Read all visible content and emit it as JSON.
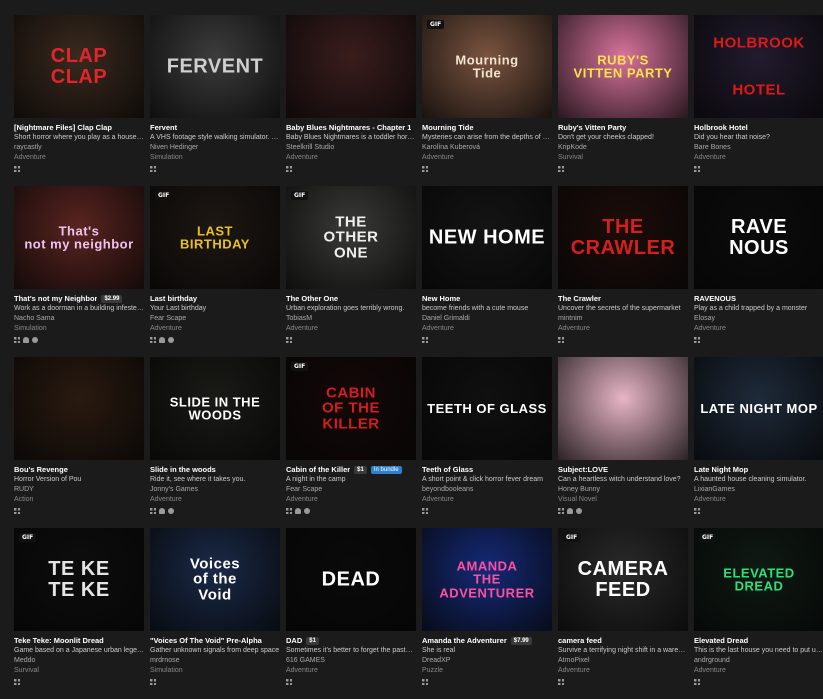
{
  "games": [
    {
      "title": "[Nightmare Files] Clap Clap",
      "desc": "Short horror where you play as a house si…",
      "author": "raycastly",
      "genre": "Adventure",
      "platforms": [
        "windows"
      ],
      "thumb_text": "CLAP\nCLAP",
      "thumb_bg": "#3a2a1e",
      "thumb_fg": "#e0262c",
      "gif": "",
      "price": "",
      "bundle": ""
    },
    {
      "title": "Fervent",
      "desc": "A VHS footage style walking simulator. E…",
      "author": "Niven Hedinger",
      "genre": "Simulation",
      "platforms": [
        "windows"
      ],
      "thumb_text": "FERVENT",
      "thumb_bg": "#3c3c3c",
      "thumb_fg": "#cfcfcf",
      "gif": "",
      "price": "",
      "bundle": ""
    },
    {
      "title": "Baby Blues Nightmares - Chapter 1",
      "desc": "Baby Blues Nightmares is a toddler horro…",
      "author": "Steelkrill Studio",
      "genre": "Adventure",
      "platforms": [
        "windows"
      ],
      "thumb_text": "",
      "thumb_bg": "#3a1d1d",
      "thumb_fg": "#ff3030",
      "gif": "",
      "price": "",
      "bundle": ""
    },
    {
      "title": "Mourning Tide",
      "desc": "Mysteries can arise from the depths of gr…",
      "author": "Karolína Kuberová",
      "genre": "Adventure",
      "platforms": [
        "windows"
      ],
      "thumb_text": "Mourning\nTide",
      "thumb_bg": "#7a5440",
      "thumb_fg": "#f2e3cf",
      "gif": "GIF",
      "price": "",
      "bundle": ""
    },
    {
      "title": "Ruby's Vitten Party",
      "desc": "Don't get your cheeks clapped!",
      "author": "KripKode",
      "genre": "Survival",
      "platforms": [
        "windows"
      ],
      "thumb_text": "RUBY'S\nVITTEN PARTY",
      "thumb_bg": "#d9739d",
      "thumb_fg": "#ffe14a",
      "gif": "",
      "price": "",
      "bundle": ""
    },
    {
      "title": "Holbrook Hotel",
      "desc": "Did you hear that noise?",
      "author": "Bare Bones",
      "genre": "Adventure",
      "platforms": [
        "windows"
      ],
      "thumb_text": "HOLBROOK\n\n\nHOTEL",
      "thumb_bg": "#221b2e",
      "thumb_fg": "#e01818",
      "gif": "",
      "price": "",
      "bundle": ""
    },
    {
      "title": "That's not my Neighbor",
      "desc": "Work as a doorman in a building infested …",
      "author": "Nacho Sama",
      "genre": "Simulation",
      "platforms": [
        "windows",
        "linux",
        "mac"
      ],
      "thumb_text": "That's\nnot my neighbor",
      "thumb_bg": "#5a2420",
      "thumb_fg": "#efc3ef",
      "gif": "",
      "price": "$2.99",
      "bundle": ""
    },
    {
      "title": "Last birthday",
      "desc": "Your Last birthday",
      "author": "Fear Scape",
      "genre": "Adventure",
      "platforms": [
        "windows",
        "linux",
        "mac"
      ],
      "thumb_text": "LAST\nBIRTHDAY",
      "thumb_bg": "#1e1713",
      "thumb_fg": "#e8c21c",
      "gif": "GIF",
      "price": "",
      "bundle": ""
    },
    {
      "title": "The Other One",
      "desc": "Urban exploration goes terribly wrong.",
      "author": "TobiasM",
      "genre": "Adventure",
      "platforms": [
        "windows"
      ],
      "thumb_text": "THE\nOTHER\nONE",
      "thumb_bg": "#3a3a38",
      "thumb_fg": "#f0f0f0",
      "gif": "GIF",
      "price": "",
      "bundle": ""
    },
    {
      "title": "New Home",
      "desc": "become friends with a cute mouse",
      "author": "Daniel Grimaldi",
      "genre": "Adventure",
      "platforms": [
        "windows"
      ],
      "thumb_text": "NEW HOME",
      "thumb_bg": "#141414",
      "thumb_fg": "#ffffff",
      "gif": "",
      "price": "",
      "bundle": ""
    },
    {
      "title": "The Crawler",
      "desc": "Uncover the secrets of the supermarket",
      "author": "mintnim",
      "genre": "Adventure",
      "platforms": [
        "windows"
      ],
      "thumb_text": "THE CRAWLER",
      "thumb_bg": "#1c0d0a",
      "thumb_fg": "#d2201e",
      "gif": "",
      "price": "",
      "bundle": ""
    },
    {
      "title": "RAVENOUS",
      "desc": "Play as a child trapped by a monster",
      "author": "Elosay",
      "genre": "Adventure",
      "platforms": [
        "windows"
      ],
      "thumb_text": "RAVE\nNOUS",
      "thumb_bg": "#0c0c0c",
      "thumb_fg": "#ffffff",
      "gif": "",
      "price": "",
      "bundle": ""
    },
    {
      "title": "Bou's Revenge",
      "desc": "Horror Version of Pou",
      "author": "RUDY",
      "genre": "Action",
      "platforms": [
        "windows"
      ],
      "thumb_text": "",
      "thumb_bg": "#2a1a10",
      "thumb_fg": "#b86a3c",
      "gif": "",
      "price": "",
      "bundle": ""
    },
    {
      "title": "Slide in the woods",
      "desc": "Ride it, see where it takes you.",
      "author": "Jonny's Games",
      "genre": "Adventure",
      "platforms": [
        "windows",
        "linux",
        "mac"
      ],
      "thumb_text": "SLIDE IN THE WOODS",
      "thumb_bg": "#1a1a16",
      "thumb_fg": "#ffffff",
      "gif": "",
      "price": "",
      "bundle": ""
    },
    {
      "title": "Cabin of the Killer",
      "desc": "A night in the camp",
      "author": "Fear Scape",
      "genre": "Adventure",
      "platforms": [
        "windows",
        "linux",
        "mac"
      ],
      "thumb_text": "CABIN\nOF THE\nKILLER",
      "thumb_bg": "#140808",
      "thumb_fg": "#d21e1e",
      "gif": "GIF",
      "price": "$1",
      "bundle": "In bundle"
    },
    {
      "title": "Teeth of Glass",
      "desc": "A short point & click horror fever dream",
      "author": "beyondbooleans",
      "genre": "Adventure",
      "platforms": [
        "windows"
      ],
      "thumb_text": "TEETH OF GLASS",
      "thumb_bg": "#101010",
      "thumb_fg": "#ffffff",
      "gif": "",
      "price": "",
      "bundle": ""
    },
    {
      "title": "Subject:LOVE",
      "desc": "Can a heartless witch understand love?",
      "author": "Honey Bunny",
      "genre": "Visual Novel",
      "platforms": [
        "windows",
        "linux",
        "mac"
      ],
      "thumb_text": "",
      "thumb_bg": "#e7b5c5",
      "thumb_fg": "#7a2c47",
      "gif": "",
      "price": "",
      "bundle": ""
    },
    {
      "title": "Late Night Mop",
      "desc": "A haunted house cleaning simulator.",
      "author": "LixianGames",
      "genre": "Adventure",
      "platforms": [
        "windows"
      ],
      "thumb_text": "LATE NIGHT MOP",
      "thumb_bg": "#1e2a3a",
      "thumb_fg": "#ffffff",
      "gif": "",
      "price": "",
      "bundle": ""
    },
    {
      "title": "Teke Teke: Moonlit Dread",
      "desc": "Game based on a Japanese urban legend",
      "author": "Meddo",
      "genre": "Survival",
      "platforms": [
        "windows"
      ],
      "thumb_text": "TE KE\nTE KE",
      "thumb_bg": "#0d0d0d",
      "thumb_fg": "#e4e4e4",
      "gif": "GIF",
      "price": "",
      "bundle": ""
    },
    {
      "title": "\"Voices Of The Void\" Pre-Alpha",
      "desc": "Gather unknown signals from deep space",
      "author": "mrdrnose",
      "genre": "Simulation",
      "platforms": [
        "windows"
      ],
      "thumb_text": "Voices\nof the\nVoid",
      "thumb_bg": "#1a2a48",
      "thumb_fg": "#ffffff",
      "gif": "",
      "price": "",
      "bundle": ""
    },
    {
      "title": "DAD",
      "desc": "Sometimes it's better to forget the past…",
      "author": "616 GAMES",
      "genre": "Adventure",
      "platforms": [
        "windows"
      ],
      "thumb_text": "DEAD",
      "thumb_bg": "#0a0a0a",
      "thumb_fg": "#ffffff",
      "gif": "",
      "price": "$1",
      "bundle": ""
    },
    {
      "title": "Amanda the Adventurer",
      "desc": "She is real",
      "author": "DreadXP",
      "genre": "Puzzle",
      "platforms": [
        "windows"
      ],
      "thumb_text": "AMANDA\nTHE ADVENTURER",
      "thumb_bg": "#152a78",
      "thumb_fg": "#ff4fa0",
      "gif": "",
      "price": "$7.99",
      "bundle": ""
    },
    {
      "title": "camera feed",
      "desc": "Survive a terrifying night shift in a wareh…",
      "author": "AtmoPixel",
      "genre": "Adventure",
      "platforms": [
        "windows"
      ],
      "thumb_text": "CAMERA FEED",
      "thumb_bg": "#2a2a2a",
      "thumb_fg": "#ffffff",
      "gif": "GIF",
      "price": "",
      "bundle": ""
    },
    {
      "title": "Elevated Dread",
      "desc": "This is the last house you need to put up …",
      "author": "andrground",
      "genre": "Adventure",
      "platforms": [
        "windows"
      ],
      "thumb_text": "ELEVATED\nDREAD",
      "thumb_bg": "#0f1a14",
      "thumb_fg": "#2fe07a",
      "gif": "GIF",
      "price": "",
      "bundle": ""
    }
  ]
}
